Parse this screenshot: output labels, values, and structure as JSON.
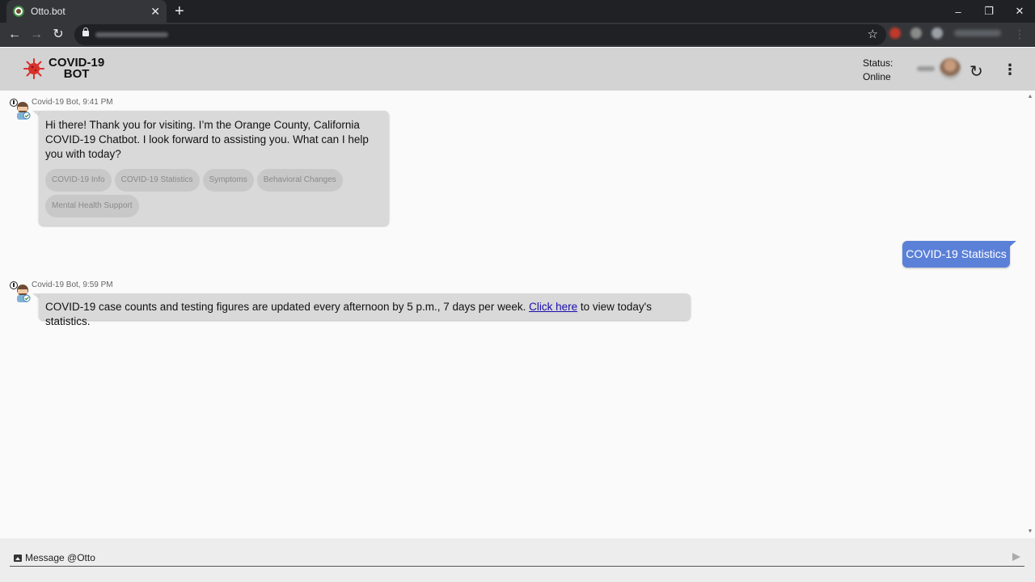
{
  "browser": {
    "tab_title": "Otto.bot",
    "tab_close": "✕",
    "new_tab": "+",
    "window_controls": [
      "–",
      "❐",
      "✕"
    ]
  },
  "header": {
    "logo_line1": "COVID-19",
    "logo_line2": "BOT",
    "status_label": "Status:",
    "status_value": "Online"
  },
  "messages": [
    {
      "meta": "Covid-19 Bot, 9:41 PM",
      "text": "Hi there! Thank you for visiting. I’m the Orange County, California COVID-19 Chatbot. I look forward to assisting you. What can I help you with today?",
      "quick_replies": [
        "COVID-19 Info",
        "COVID-19 Statistics",
        "Symptoms",
        "Behavioral Changes",
        "Mental Health Support"
      ]
    },
    {
      "user_text": "COVID-19 Statistics"
    },
    {
      "meta": "Covid-19 Bot, 9:59 PM",
      "text_before": "COVID-19 case counts and testing figures are updated every afternoon by 5 p.m., 7 days per week. ",
      "link_text": "Click here",
      "text_after": " to view today's statistics."
    }
  ],
  "composer": {
    "placeholder": "Message @Otto"
  },
  "colors": {
    "header_bg": "#d3d3d3",
    "bot_bubble": "#d9d9d9",
    "user_bubble": "#5b80d8",
    "logo_virus": "#d9302a"
  }
}
